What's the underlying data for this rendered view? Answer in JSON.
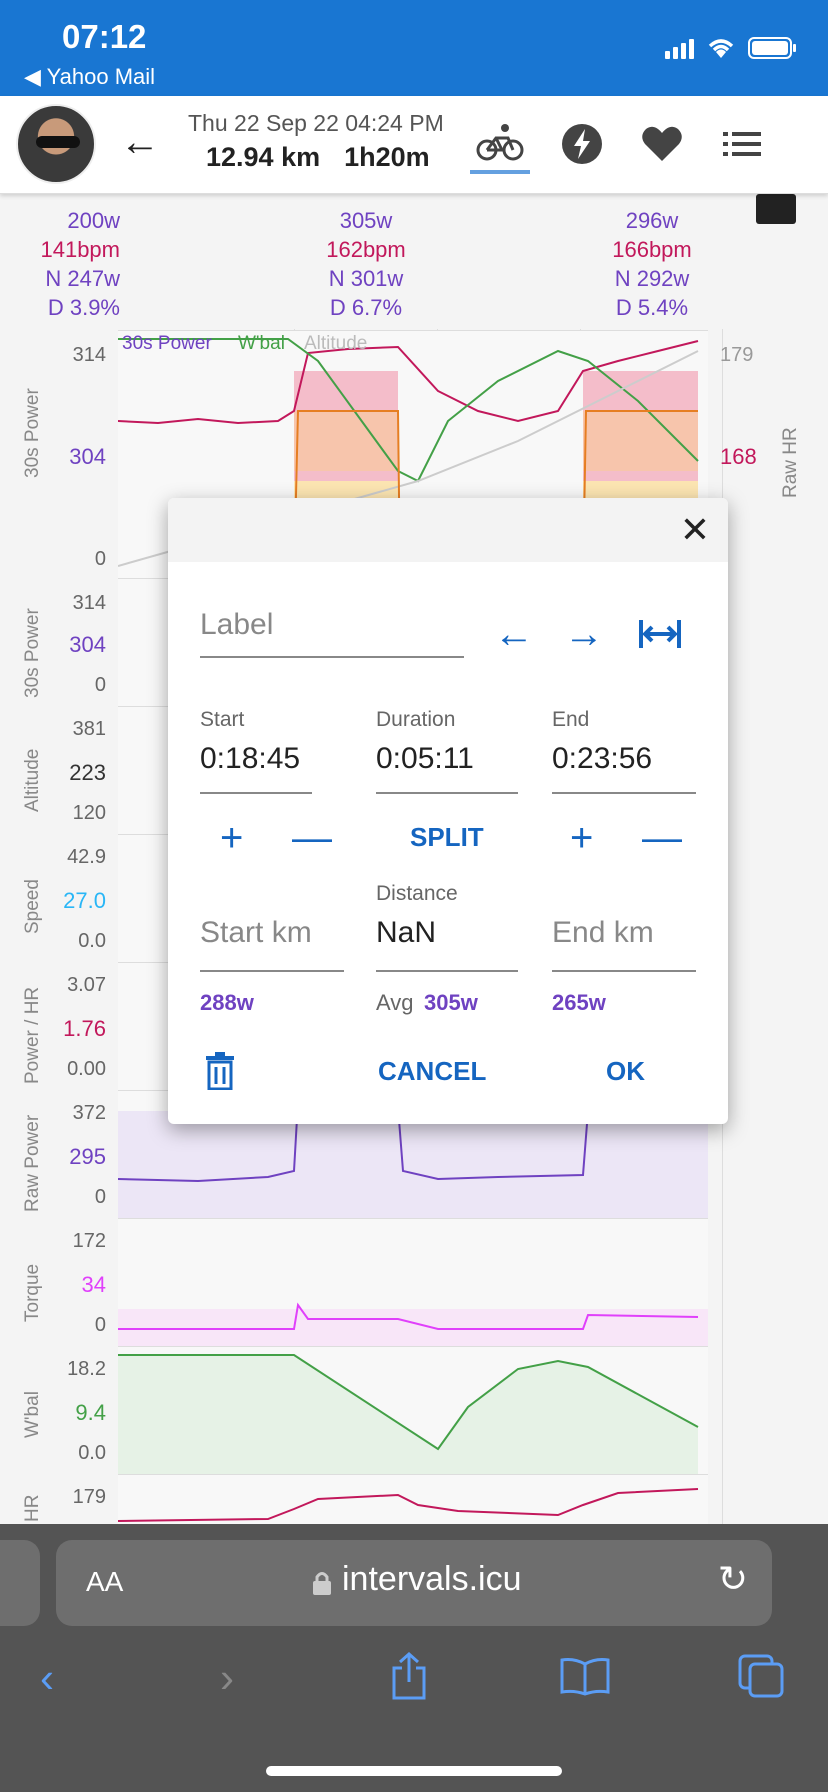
{
  "status": {
    "time": "07:12",
    "back_app": "◀ Yahoo Mail"
  },
  "header": {
    "date": "Thu 22 Sep 22 04:24 PM",
    "distance": "12.94 km",
    "duration": "1h20m"
  },
  "laps": [
    {
      "power": "200w",
      "hr": "141bpm",
      "np": "N 247w",
      "decoupling": "D 3.9%"
    },
    {
      "power": "305w",
      "hr": "162bpm",
      "np": "N 301w",
      "decoupling": "D 6.7%"
    },
    {
      "power": "296w",
      "hr": "166bpm",
      "np": "N 292w",
      "decoupling": "D 5.4%"
    }
  ],
  "charts": [
    {
      "name": "30s Power",
      "top": "314",
      "mid": "304",
      "bot": "0",
      "legend": [
        "30s Power",
        "W'bal",
        "Altitude"
      ],
      "right_top": "179",
      "right_mid": "168",
      "right_label": "Raw HR"
    },
    {
      "name": "30s Power",
      "top": "314",
      "mid": "304",
      "bot": "0"
    },
    {
      "name": "Altitude",
      "top": "381",
      "mid": "223",
      "bot": "120"
    },
    {
      "name": "Speed",
      "top": "42.9",
      "mid": "27.0",
      "bot": "0.0"
    },
    {
      "name": "Power / HR",
      "top": "3.07",
      "mid": "1.76",
      "bot": "0.00"
    },
    {
      "name": "Raw Power",
      "top": "372",
      "mid": "295",
      "bot": "0"
    },
    {
      "name": "Torque",
      "top": "172",
      "mid": "34",
      "bot": "0"
    },
    {
      "name": "W'bal",
      "top": "18.2",
      "mid": "9.4",
      "bot": "0.0"
    },
    {
      "name": "HR",
      "top": "179"
    }
  ],
  "colors": {
    "primary": "#1976d2",
    "power": "#6f42c1",
    "hr": "#c2185b",
    "wbal": "#43a047",
    "torque": "#e040fb",
    "speed": "#29b6f6"
  },
  "dialog": {
    "label_placeholder": "Label",
    "start_label": "Start",
    "start_value": "0:18:45",
    "duration_label": "Duration",
    "duration_value": "0:05:11",
    "end_label": "End",
    "end_value": "0:23:56",
    "split_label": "SPLIT",
    "distance_label": "Distance",
    "start_km_placeholder": "Start km",
    "distance_value": "NaN",
    "end_km_placeholder": "End km",
    "start_power": "288w",
    "avg_label": "Avg",
    "avg_power": "305w",
    "end_power": "265w",
    "cancel_label": "CANCEL",
    "ok_label": "OK"
  },
  "safari": {
    "aa": "AA",
    "url": "intervals.icu"
  }
}
